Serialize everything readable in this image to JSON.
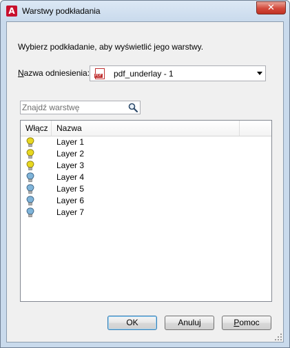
{
  "window": {
    "title": "Warstwy podkładania",
    "close_label": "✕"
  },
  "dialog": {
    "instruction": "Wybierz podkładanie, aby wyświetlić jego warstwy.",
    "ref_label_prefix": "N",
    "ref_label_rest": "azwa odniesienia:",
    "ref_value": "pdf_underlay - 1",
    "ref_icon_text": "PDF",
    "search": {
      "placeholder": "Znajdź warstwę",
      "value": ""
    },
    "list": {
      "columns": {
        "on": "Włącz",
        "name": "Nazwa",
        "extra": ""
      },
      "rows": [
        {
          "name": "Layer 1",
          "on": true,
          "color": "#e8d820"
        },
        {
          "name": "Layer 2",
          "on": true,
          "color": "#e8d820"
        },
        {
          "name": "Layer 3",
          "on": true,
          "color": "#e8d820"
        },
        {
          "name": "Layer 4",
          "on": false,
          "color": "#7fb4d9"
        },
        {
          "name": "Layer 5",
          "on": false,
          "color": "#7fb4d9"
        },
        {
          "name": "Layer 6",
          "on": false,
          "color": "#7fb4d9"
        },
        {
          "name": "Layer 7",
          "on": false,
          "color": "#7fb4d9"
        }
      ]
    },
    "buttons": {
      "ok": "OK",
      "cancel": "Anuluj",
      "help_prefix": "P",
      "help_rest": "omoc"
    }
  }
}
